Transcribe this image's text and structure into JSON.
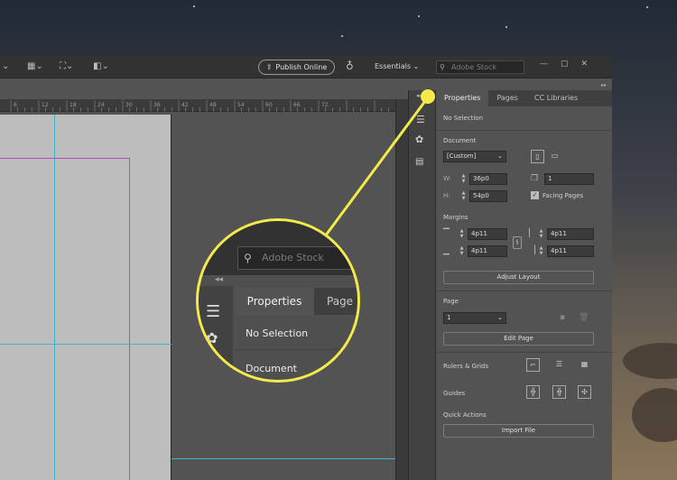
{
  "topbar": {
    "publish_label": "Publish Online",
    "workspace_label": "Essentials",
    "search_placeholder": "Adobe Stock"
  },
  "ruler": {
    "ticks": [
      "6",
      "12",
      "18",
      "24",
      "30",
      "36",
      "42",
      "48",
      "54",
      "60",
      "66",
      "72"
    ]
  },
  "panel": {
    "tabs": [
      "Properties",
      "Pages",
      "CC Libraries"
    ],
    "active_tab": "Properties",
    "selection_status": "No Selection",
    "document": {
      "label": "Document",
      "preset": "[Custom]",
      "width_label": "W:",
      "width": "36p0",
      "height_label": "H:",
      "height": "54p0",
      "pages": "1",
      "facing_pages_label": "Facing Pages",
      "facing_pages_checked": true
    },
    "margins": {
      "label": "Margins",
      "top": "4p11",
      "bottom": "4p11",
      "left": "4p11",
      "right": "4p11",
      "adjust_label": "Adjust Layout"
    },
    "page": {
      "label": "Page",
      "value": "1",
      "edit_label": "Edit Page"
    },
    "rulers_grids_label": "Rulers & Grids",
    "guides_label": "Guides",
    "quick_actions": {
      "label": "Quick Actions",
      "import_label": "Import File"
    }
  },
  "zoom": {
    "search_placeholder": "Adobe Stock",
    "tab_properties": "Properties",
    "tab_pages": "Page",
    "selection_status": "No Selection",
    "document_label": "Document"
  },
  "colors": {
    "callout": "#f4ea4c",
    "guide": "#3fb6c8",
    "margin_guide": "#b04cc4"
  }
}
